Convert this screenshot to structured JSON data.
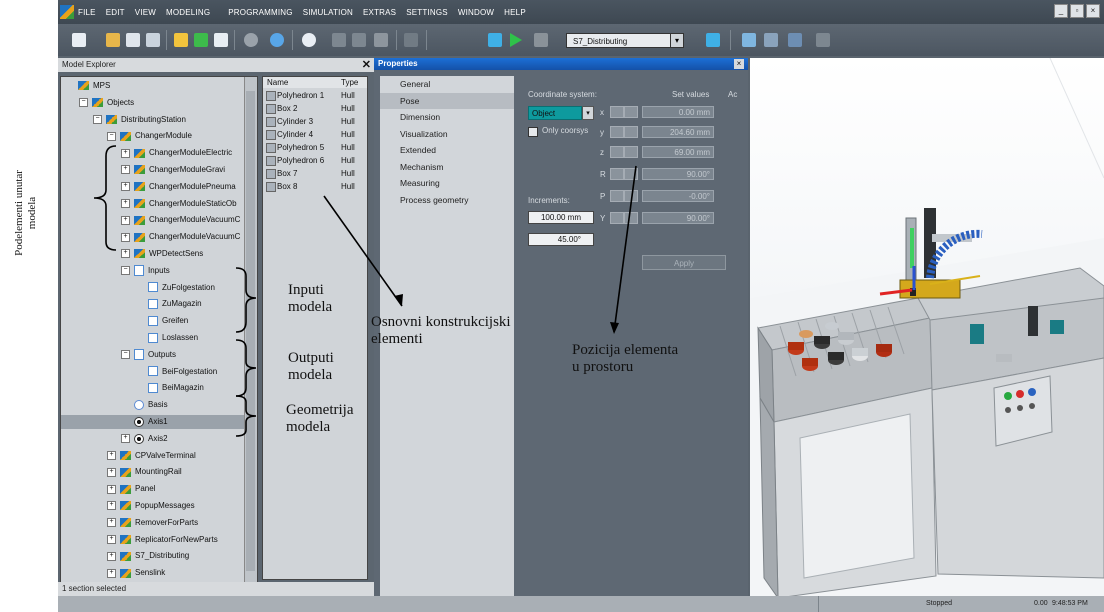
{
  "annotations": {
    "side_label": "Podelementi unutar\nmodela",
    "inputs": "Inputi\nmodela",
    "outputs": "Outputi\nmodela",
    "geometry": "Geometrija\nmodela",
    "basic_elements": "Osnovni konstrukcijski\nelementi",
    "position": "Pozicija elementa\nu prostoru"
  },
  "menu": [
    "FILE",
    "EDIT",
    "VIEW",
    "MODELING",
    "PROGRAMMING",
    "SIMULATION",
    "EXTRAS",
    "SETTINGS",
    "WINDOW",
    "HELP"
  ],
  "toolbar": {
    "program_combo": "S7_Distributing"
  },
  "explorer": {
    "title": "Model Explorer",
    "status": "1 section selected",
    "tree": [
      {
        "label": "MPS",
        "level": 0,
        "icon": "model",
        "exp": ""
      },
      {
        "label": "Objects",
        "level": 1,
        "icon": "model",
        "exp": "−"
      },
      {
        "label": "DistributingStation",
        "level": 2,
        "icon": "model",
        "exp": "−"
      },
      {
        "label": "ChangerModule",
        "level": 3,
        "icon": "model",
        "exp": "−"
      },
      {
        "label": "ChangerModuleElectric",
        "level": 4,
        "icon": "model",
        "exp": "+"
      },
      {
        "label": "ChangerModuleGravi",
        "level": 4,
        "icon": "model",
        "exp": "+"
      },
      {
        "label": "ChangerModulePneuma",
        "level": 4,
        "icon": "model",
        "exp": "+"
      },
      {
        "label": "ChangerModuleStaticOb",
        "level": 4,
        "icon": "model",
        "exp": "+"
      },
      {
        "label": "ChangerModuleVacuumC",
        "level": 4,
        "icon": "model",
        "exp": "+"
      },
      {
        "label": "ChangerModuleVacuumC",
        "level": 4,
        "icon": "model",
        "exp": "+"
      },
      {
        "label": "WPDetectSens",
        "level": 4,
        "icon": "model",
        "exp": "+"
      },
      {
        "label": "Inputs",
        "level": 4,
        "icon": "io",
        "exp": "−"
      },
      {
        "label": "ZuFolgestation",
        "level": 5,
        "icon": "sig",
        "exp": ""
      },
      {
        "label": "ZuMagazin",
        "level": 5,
        "icon": "sig",
        "exp": ""
      },
      {
        "label": "Greifen",
        "level": 5,
        "icon": "sig",
        "exp": ""
      },
      {
        "label": "Loslassen",
        "level": 5,
        "icon": "sig",
        "exp": ""
      },
      {
        "label": "Outputs",
        "level": 4,
        "icon": "io",
        "exp": "−"
      },
      {
        "label": "BeiFolgestation",
        "level": 5,
        "icon": "sig",
        "exp": ""
      },
      {
        "label": "BeiMagazin",
        "level": 5,
        "icon": "sig",
        "exp": ""
      },
      {
        "label": "Basis",
        "level": 4,
        "icon": "basis",
        "exp": ""
      },
      {
        "label": "Axis1",
        "level": 4,
        "icon": "axis",
        "exp": "",
        "selected": true
      },
      {
        "label": "Axis2",
        "level": 4,
        "icon": "axis",
        "exp": "+"
      },
      {
        "label": "CPValveTerminal",
        "level": 3,
        "icon": "model",
        "exp": "+"
      },
      {
        "label": "MountingRail",
        "level": 3,
        "icon": "model",
        "exp": "+"
      },
      {
        "label": "Panel",
        "level": 3,
        "icon": "model",
        "exp": "+"
      },
      {
        "label": "PopupMessages",
        "level": 3,
        "icon": "model",
        "exp": "+"
      },
      {
        "label": "RemoverForParts",
        "level": 3,
        "icon": "model",
        "exp": "+"
      },
      {
        "label": "ReplicatorForNewParts",
        "level": 3,
        "icon": "model",
        "exp": "+"
      },
      {
        "label": "S7_Distributing",
        "level": 3,
        "icon": "model",
        "exp": "+"
      },
      {
        "label": "Senslink",
        "level": 3,
        "icon": "model",
        "exp": "+"
      }
    ]
  },
  "geometry": {
    "headers": {
      "name": "Name",
      "type": "Type"
    },
    "rows": [
      {
        "name": "Polyhedron 1",
        "type": "Hull"
      },
      {
        "name": "Box 2",
        "type": "Hull"
      },
      {
        "name": "Cylinder 3",
        "type": "Hull"
      },
      {
        "name": "Cylinder 4",
        "type": "Hull"
      },
      {
        "name": "Polyhedron 5",
        "type": "Hull"
      },
      {
        "name": "Polyhedron 6",
        "type": "Hull"
      },
      {
        "name": "Box 7",
        "type": "Hull"
      },
      {
        "name": "Box 8",
        "type": "Hull"
      }
    ]
  },
  "properties": {
    "title": "Properties",
    "categories": [
      "General",
      "Pose",
      "Dimension",
      "Visualization",
      "Extended",
      "Mechanism",
      "Measuring",
      "Process geometry"
    ],
    "selected_category": "Pose",
    "coord_label": "Coordinate system:",
    "set_values_label": "Set values",
    "ac_label": "Ac",
    "coord_value": "Object",
    "only_coorsys": "Only coorsys",
    "increments_label": "Increments:",
    "inc_linear": "100.00 mm",
    "inc_angle": "45.00°",
    "axes": [
      {
        "axis": "x",
        "value": "0.00 mm"
      },
      {
        "axis": "y",
        "value": "204.60 mm"
      },
      {
        "axis": "z",
        "value": "69.00 mm"
      },
      {
        "axis": "R",
        "value": "90.00°"
      },
      {
        "axis": "P",
        "value": "-0.00°"
      },
      {
        "axis": "Y",
        "value": "90.00°"
      }
    ],
    "apply": "Apply"
  },
  "statusbar": {
    "state": "Stopped",
    "value": "0.00",
    "time": "9:48:53 PM"
  },
  "colors": {
    "title_blue": "#1c6fd6",
    "object_combo": "#0e9a9e"
  }
}
